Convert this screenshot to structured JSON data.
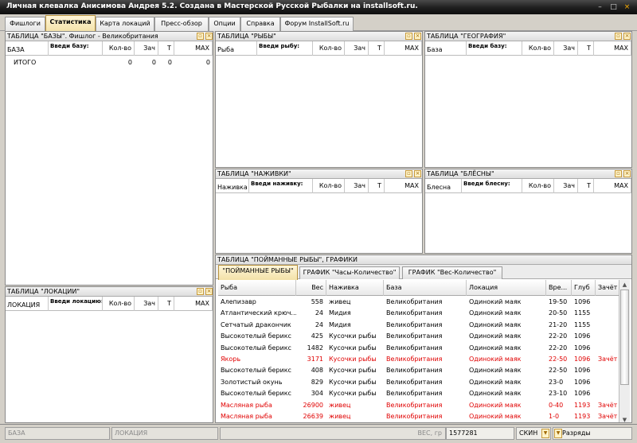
{
  "window": {
    "title": "Личная клевалка Анисимова Андрея 5.2. Создана в Мастерской Русской Рыбалки на installsoft.ru.",
    "controls": [
      "–",
      "□",
      "×"
    ]
  },
  "top_tabs": [
    "Фишлоги",
    "Статистика",
    "Карта локаций",
    "Пресс-обзор",
    "Опции",
    "Справка",
    "Форум InstallSoft.ru"
  ],
  "active_top_tab": "Статистика",
  "panel_button_icons": [
    "restore-icon",
    "close-icon"
  ],
  "bases_panel": {
    "title": "ТАБЛИЦА \"БАЗЫ\". Фишлог  -  Великобритания",
    "col_label": "БАЗА",
    "filter_label": "Введи базу:",
    "columns": [
      "Кол-во",
      "Зач",
      "Т",
      "MAX"
    ],
    "total_row": {
      "label": "ИТОГО",
      "values": [
        "0",
        "0",
        "0",
        "0"
      ]
    }
  },
  "locations_panel": {
    "title": "ТАБЛИЦА \"ЛОКАЦИИ\"",
    "col_label": "ЛОКАЦИЯ",
    "filter_label": "Введи локацию:",
    "columns": [
      "Кол-во",
      "Зач",
      "Т",
      "MAX"
    ]
  },
  "fish_panel": {
    "title": "ТАБЛИЦА \"РЫБЫ\"",
    "col_label": "Рыба",
    "filter_label": "Введи рыбу:",
    "columns": [
      "Кол-во",
      "Зач",
      "Т",
      "MAX"
    ]
  },
  "geo_panel": {
    "title": "ТАБЛИЦА \"ГЕОГРАФИЯ\"",
    "col_label": "База",
    "filter_label": "Введи базу:",
    "columns": [
      "Кол-во",
      "Зач",
      "Т",
      "MAX"
    ]
  },
  "bait_panel": {
    "title": "ТАБЛИЦА \"НАЖИВКИ\"",
    "col_label": "Наживка",
    "filter_label": "Введи наживку:",
    "columns": [
      "Кол-во",
      "Зач",
      "Т",
      "MAX"
    ]
  },
  "lure_panel": {
    "title": "ТАБЛИЦА \"БЛЁСНЫ\"",
    "col_label": "Блесна",
    "filter_label": "Введи блесну:",
    "columns": [
      "Кол-во",
      "Зач",
      "Т",
      "MAX"
    ]
  },
  "caught_panel": {
    "title": "ТАБЛИЦА \"ПОЙМАННЫЕ РЫБЫ\", ГРАФИКИ",
    "tabs": [
      "\"ПОЙМАННЫЕ РЫБЫ\"",
      "ГРАФИК \"Часы-Количество\"",
      "ГРАФИК \"Вес-Количество\""
    ],
    "active_tab": "\"ПОЙМАННЫЕ РЫБЫ\"",
    "columns": [
      "Рыба",
      "Вес",
      "Наживка",
      "База",
      "Локация",
      "Вре...",
      "Глуб",
      "Зачёт"
    ],
    "scroll_up": "▲",
    "scroll_down": "▼",
    "rows": [
      {
        "fish": "Алепизавр",
        "weight": "558",
        "bait": "живец",
        "base": "Великобритания",
        "location": "Одинокий маяк",
        "time": "19-50",
        "depth": "1096",
        "credit": "",
        "highlight": false
      },
      {
        "fish": "Атлантический крюч...",
        "weight": "24",
        "bait": "Мидия",
        "base": "Великобритания",
        "location": "Одинокий маяк",
        "time": "20-50",
        "depth": "1155",
        "credit": "",
        "highlight": false
      },
      {
        "fish": "Сетчатый дракончик",
        "weight": "24",
        "bait": "Мидия",
        "base": "Великобритания",
        "location": "Одинокий маяк",
        "time": "21-20",
        "depth": "1155",
        "credit": "",
        "highlight": false
      },
      {
        "fish": "Высокотелый берикс",
        "weight": "425",
        "bait": "Кусочки рыбы",
        "base": "Великобритания",
        "location": "Одинокий маяк",
        "time": "22-20",
        "depth": "1096",
        "credit": "",
        "highlight": false
      },
      {
        "fish": "Высокотелый берикс",
        "weight": "1482",
        "bait": "Кусочки рыбы",
        "base": "Великобритания",
        "location": "Одинокий маяк",
        "time": "22-20",
        "depth": "1096",
        "credit": "",
        "highlight": false
      },
      {
        "fish": "Якорь",
        "weight": "3171",
        "bait": "Кусочки рыбы",
        "base": "Великобритания",
        "location": "Одинокий маяк",
        "time": "22-50",
        "depth": "1096",
        "credit": "Зачёт",
        "highlight": true
      },
      {
        "fish": "Высокотелый берикс",
        "weight": "408",
        "bait": "Кусочки рыбы",
        "base": "Великобритания",
        "location": "Одинокий маяк",
        "time": "22-50",
        "depth": "1096",
        "credit": "",
        "highlight": false
      },
      {
        "fish": "Золотистый окунь",
        "weight": "829",
        "bait": "Кусочки рыбы",
        "base": "Великобритания",
        "location": "Одинокий маяк",
        "time": "23-0",
        "depth": "1096",
        "credit": "",
        "highlight": false
      },
      {
        "fish": "Высокотелый берикс",
        "weight": "304",
        "bait": "Кусочки рыбы",
        "base": "Великобритания",
        "location": "Одинокий маяк",
        "time": "23-10",
        "depth": "1096",
        "credit": "",
        "highlight": false
      },
      {
        "fish": "Масляная рыба",
        "weight": "26900",
        "bait": "живец",
        "base": "Великобритания",
        "location": "Одинокий маяк",
        "time": "0-40",
        "depth": "1193",
        "credit": "Зачёт",
        "highlight": true
      },
      {
        "fish": "Масляная рыба",
        "weight": "26639",
        "bait": "живец",
        "base": "Великобритания",
        "location": "Одинокий маяк",
        "time": "1-0",
        "depth": "1193",
        "credit": "Зачёт",
        "highlight": true
      }
    ]
  },
  "status_bar": {
    "base": "БАЗА",
    "location": "ЛОКАЦИЯ",
    "weight_label": "ВЕС, гр",
    "value": "1577281",
    "skin_label": "СКИН",
    "dropdown_icon": "▼",
    "digits_label": "Разряды"
  },
  "colors": {
    "highlight_text": "#e00000",
    "active_tab": "#f3e1a8",
    "titlebar": "#1e1e1e"
  }
}
